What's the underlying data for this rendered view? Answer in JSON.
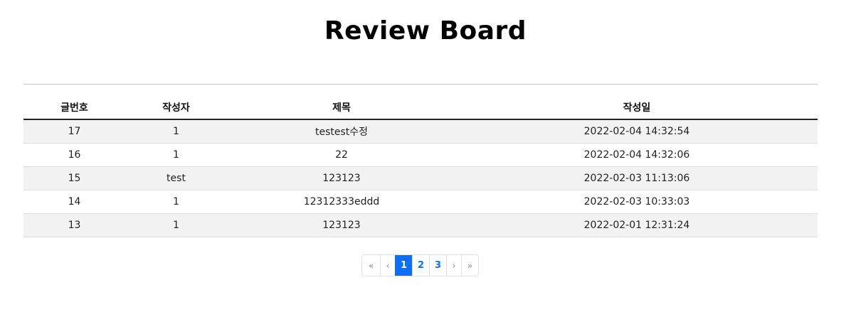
{
  "page": {
    "title": "Review Board"
  },
  "table": {
    "headers": {
      "no": "글번호",
      "writer": "작성자",
      "title": "제목",
      "date": "작성일"
    },
    "rows": [
      {
        "no": "17",
        "writer": "1",
        "title": "testest수정",
        "date": "2022-02-04 14:32:54"
      },
      {
        "no": "16",
        "writer": "1",
        "title": "22",
        "date": "2022-02-04 14:32:06"
      },
      {
        "no": "15",
        "writer": "test",
        "title": "123123",
        "date": "2022-02-03 11:13:06"
      },
      {
        "no": "14",
        "writer": "1",
        "title": "12312333eddd",
        "date": "2022-02-03 10:33:03"
      },
      {
        "no": "13",
        "writer": "1",
        "title": "123123",
        "date": "2022-02-01 12:31:24"
      }
    ]
  },
  "pagination": {
    "first": "«",
    "prev": "‹",
    "pages": [
      "1",
      "2",
      "3"
    ],
    "current": "1",
    "next": "›",
    "last": "»",
    "accent_color": "#0d6efd"
  }
}
